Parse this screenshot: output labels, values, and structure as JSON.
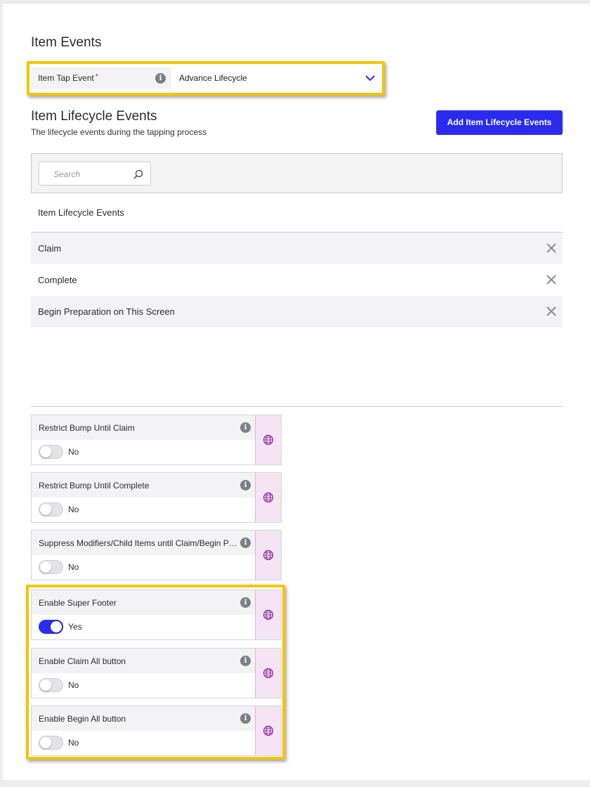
{
  "item_events": {
    "title": "Item Events",
    "tap_event": {
      "label": "Item Tap Event",
      "required_mark": "*",
      "value": "Advance Lifecycle"
    }
  },
  "lifecycle": {
    "title": "Item Lifecycle Events",
    "subtitle": "The lifecycle events during the tapping process",
    "add_button": "Add Item Lifecycle Events",
    "search_placeholder": "Search",
    "list_header": "Item Lifecycle Events",
    "rows": [
      {
        "label": "Claim"
      },
      {
        "label": "Complete"
      },
      {
        "label": "Begin Preparation on This Screen"
      }
    ]
  },
  "settings": [
    {
      "label": "Restrict Bump Until Claim",
      "enabled": false,
      "state_text": "No"
    },
    {
      "label": "Restrict Bump Until Complete",
      "enabled": false,
      "state_text": "No"
    },
    {
      "label": "Suppress Modifiers/Child Items until Claim/Begin Preparation",
      "enabled": false,
      "state_text": "No"
    },
    {
      "label": "Enable Super Footer",
      "enabled": true,
      "state_text": "Yes"
    },
    {
      "label": "Enable Claim All button",
      "enabled": false,
      "state_text": "No"
    },
    {
      "label": "Enable Begin All button",
      "enabled": false,
      "state_text": "No"
    }
  ],
  "colors": {
    "primary": "#2b2bf0",
    "highlight": "#f6c400",
    "globe_bg": "#f4e4f4",
    "globe_icon": "#8a2a9a"
  },
  "icons": {
    "info": "info-icon",
    "close": "close-icon",
    "dropdown": "chevron-down-icon",
    "search": "search-icon",
    "globe": "globe-icon"
  }
}
